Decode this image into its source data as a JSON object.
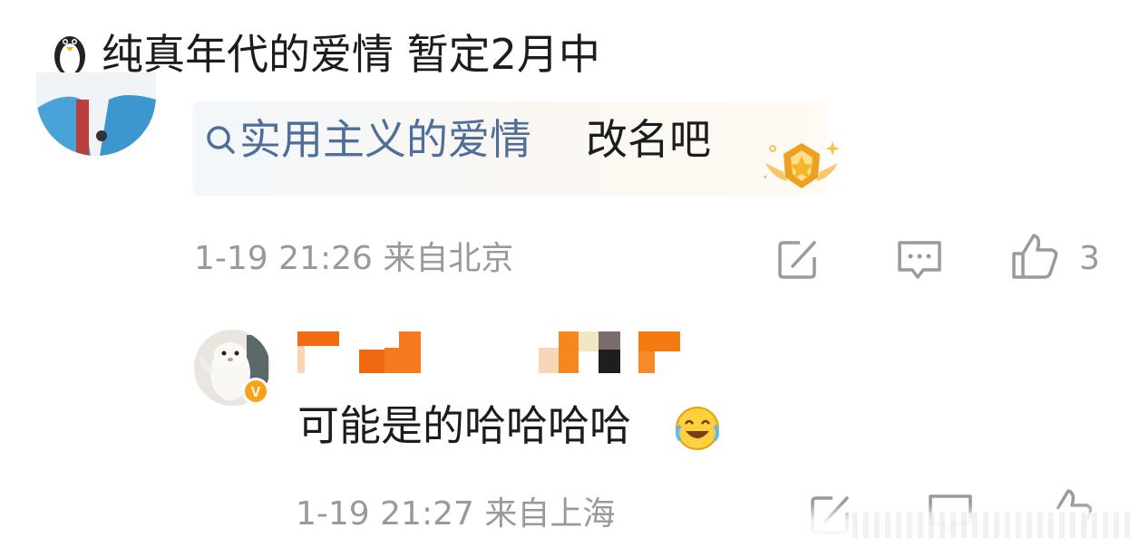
{
  "header": {
    "icon": "penguin-icon",
    "title": "纯真年代的爱情 暂定2月中"
  },
  "comment": {
    "link_text": "实用主义的爱情",
    "text": "改名吧",
    "meta": "1-19 21:26 来自北京",
    "like_count": "3",
    "link_color": "#4f6f9a"
  },
  "reply": {
    "text": "可能是的哈哈哈哈",
    "meta": "1-19 21:27 来自上海",
    "emoji": "laughing-crying-emoji",
    "verified_badge": "V"
  },
  "colors": {
    "meta": "#999999",
    "badge_orange": "#f0a020",
    "username_blur": "#f26b10"
  }
}
